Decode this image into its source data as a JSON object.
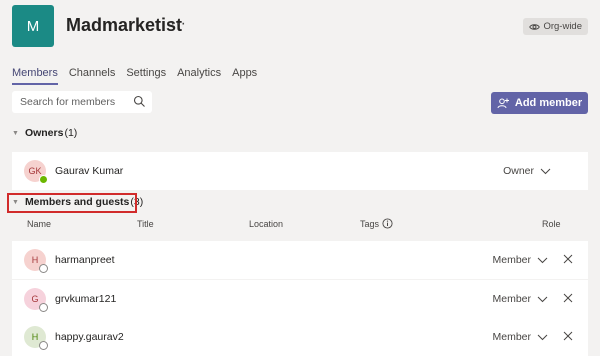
{
  "team": {
    "initial": "M",
    "name": "Madmarketist",
    "more": "···",
    "visibility": "Org-wide"
  },
  "tabs": [
    "Members",
    "Channels",
    "Settings",
    "Analytics",
    "Apps"
  ],
  "search": {
    "placeholder": "Search for members"
  },
  "add_member_label": "Add member",
  "owners": {
    "title": "Owners",
    "count": "(1)",
    "rows": [
      {
        "initials": "GK",
        "name": "Gaurav Kumar",
        "role": "Owner"
      }
    ]
  },
  "members": {
    "title": "Members and guests",
    "count": "(3)",
    "columns": {
      "name": "Name",
      "title": "Title",
      "location": "Location",
      "tags": "Tags",
      "role": "Role"
    },
    "rows": [
      {
        "initials": "H",
        "name": "harmanpreet",
        "role": "Member"
      },
      {
        "initials": "G",
        "name": "grvkumar121",
        "role": "Member"
      },
      {
        "initials": "H",
        "name": "happy.gaurav2",
        "role": "Member"
      }
    ]
  },
  "colors": {
    "accent": "#6264a7",
    "team_avatar": "#1b8a85",
    "highlight": "#d12b2b"
  }
}
